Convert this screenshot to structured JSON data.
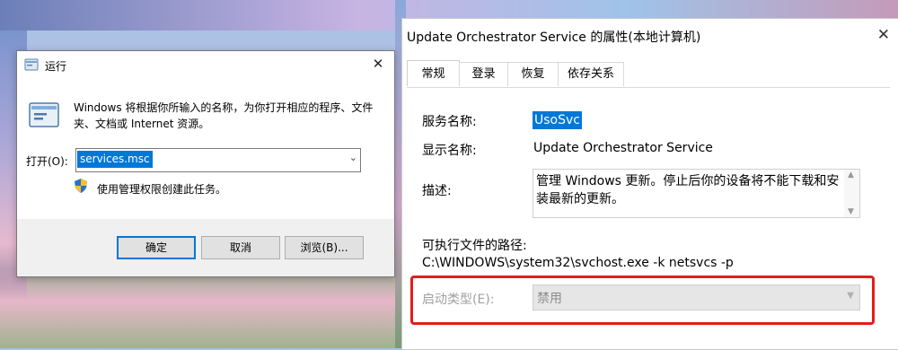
{
  "run_dialog": {
    "title": "运行",
    "description": "Windows 将根据你所输入的名称，为你打开相应的程序、文件夹、文档或 Internet 资源。",
    "open_label": "打开(O):",
    "open_value": "services.msc",
    "admin_note": "使用管理权限创建此任务。",
    "buttons": {
      "ok": "确定",
      "cancel": "取消",
      "browse": "浏览(B)..."
    }
  },
  "properties_window": {
    "title": "Update Orchestrator Service 的属性(本地计算机)",
    "tabs": [
      "常规",
      "登录",
      "恢复",
      "依存关系"
    ],
    "service_name_label": "服务名称:",
    "service_name": "UsoSvc",
    "display_name_label": "显示名称:",
    "display_name": "Update Orchestrator Service",
    "description_label": "描述:",
    "description": "管理 Windows 更新。停止后你的设备将不能下载和安装最新的更新。",
    "path_label": "可执行文件的路径:",
    "path": "C:\\WINDOWS\\system32\\svchost.exe -k netsvcs -p",
    "startup_type_label": "启动类型(E):",
    "startup_type_value": "禁用"
  },
  "icons": {
    "close": "close-icon",
    "run_app": "run-app-icon",
    "shield": "uac-shield-icon",
    "dropdown": "chevron-down-icon"
  },
  "colors": {
    "selection": "#0078d7",
    "highlight_box": "#e01e1e"
  }
}
